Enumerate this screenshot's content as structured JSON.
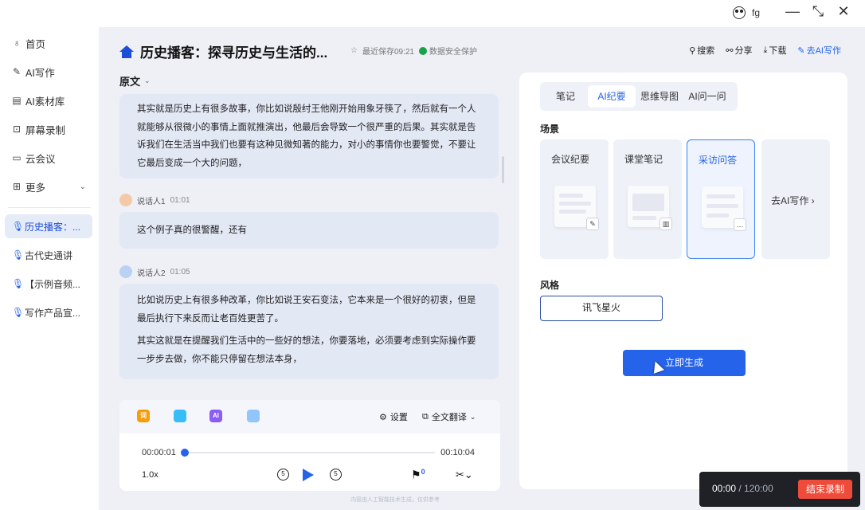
{
  "window": {
    "user_name": "fg",
    "minimize": "—",
    "maximize": "⤡",
    "close": "✕"
  },
  "sidebar": {
    "items": [
      {
        "label": "首页",
        "icon": "mic-outline-icon"
      },
      {
        "label": "AI写作",
        "icon": "edit-icon"
      },
      {
        "label": "AI素材库",
        "icon": "library-icon"
      },
      {
        "label": "屏幕录制",
        "icon": "screen-record-icon"
      },
      {
        "label": "云会议",
        "icon": "video-icon"
      },
      {
        "label": "更多",
        "icon": "grid-icon"
      }
    ],
    "recordings": [
      {
        "label": "历史播客：..."
      },
      {
        "label": "古代史通讲"
      },
      {
        "label": "【示例音频..."
      },
      {
        "label": "写作产品宣..."
      }
    ]
  },
  "header": {
    "title": "历史播客：探寻历史与生活的...",
    "save_info": "最近保存09:21",
    "security": "数据安全保护",
    "actions": {
      "search": "搜索",
      "share": "分享",
      "download": "下载",
      "ai_write": "去AI写作"
    }
  },
  "transcript": {
    "section_label": "原文",
    "block1": "其实就是历史上有很多故事，你比如说殷纣王他刚开始用象牙筷了，然后就有一个人就能够从很微小的事情上面就推演出，他最后会导致一个很严重的后果。其实就是告诉我们在生活当中我们也要有这种见微知著的能力，对小的事情你也要警觉，不要让它最后变成一个大的问题，",
    "speaker1": {
      "name": "说话人1",
      "time": "01:01",
      "text": "这个例子真的很警醒，还有"
    },
    "speaker2": {
      "name": "说话人2",
      "time": "01:05",
      "text1": "比如说历史上有很多种改革，你比如说王安石变法，它本来是一个很好的初衷，但是最后执行下来反而让老百姓更苦了。",
      "text2": "其实这就是在提醒我们生活中的一些好的想法，你要落地，必须要考虑到实际操作要一步步去做，你不能只停留在想法本身，"
    }
  },
  "player": {
    "tools": [
      "词",
      "",
      "AI",
      ""
    ],
    "settings": "设置",
    "translate": "全文翻译",
    "current_time": "00:00:01",
    "total_time": "00:10:04",
    "progress": 0.002,
    "speed": "1.0x",
    "skip": "5",
    "flag_count": "0"
  },
  "panel": {
    "tabs": [
      {
        "label": "笔记",
        "active": false
      },
      {
        "label": "AI纪要",
        "active": true
      },
      {
        "label": "思维导图",
        "active": false
      },
      {
        "label": "AI问一问",
        "active": false
      }
    ],
    "scene_label": "场景",
    "scenes": [
      {
        "label": "会议纪要",
        "selected": false
      },
      {
        "label": "课堂笔记",
        "selected": false
      },
      {
        "label": "采访问答",
        "selected": true
      },
      {
        "label": "去AI写作 ›",
        "selected": false
      }
    ],
    "style_label": "风格",
    "style_value": "讯飞星火",
    "generate": "立即生成"
  },
  "footer_note": "内容由人工智能技术生成，仅供参考",
  "recorder": {
    "elapsed": "00:00",
    "total": "120:00",
    "stop": "结束录制"
  },
  "colors": {
    "accent": "#2563eb",
    "stop": "#ef4b3a",
    "security": "#16a34a"
  }
}
